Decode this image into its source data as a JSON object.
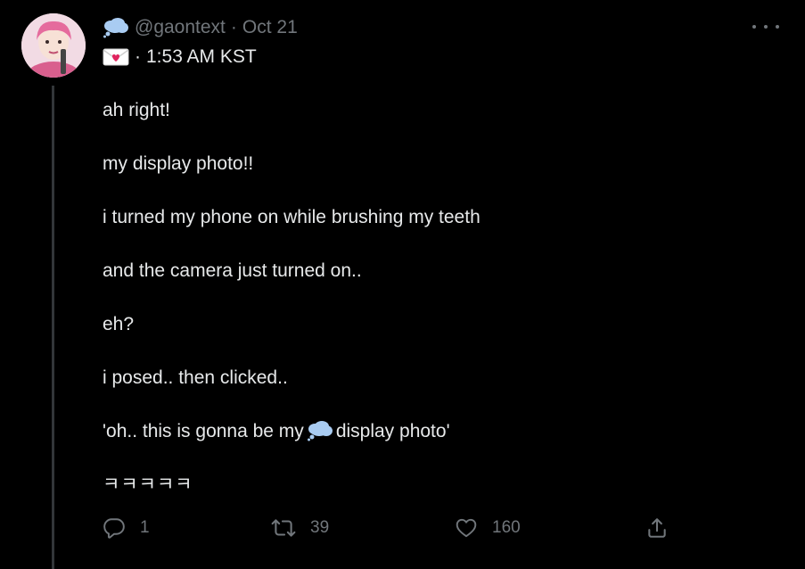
{
  "tweet": {
    "handle": "@gaontext",
    "separator": "·",
    "date": "Oct 21",
    "time_text": "1:53 AM KST",
    "lines": [
      "ah right!",
      "my display photo!!",
      "i turned my phone on while brushing my teeth",
      "and the camera just turned on..",
      "eh?",
      "i posed.. then clicked..",
      "ㅋㅋㅋㅋㅋ"
    ],
    "quote_line": {
      "before": "'oh.. this is gonna be my",
      "after": "display photo'"
    }
  },
  "actions": {
    "reply_count": "1",
    "retweet_count": "39",
    "like_count": "160"
  },
  "icons": {
    "reply": "reply-icon",
    "retweet": "retweet-icon",
    "like": "heart-icon",
    "share": "share-icon",
    "more": "more-icon",
    "header_emoji": "thought-balloon-icon",
    "time_emoji": "love-letter-icon"
  },
  "colors": {
    "background": "#000000",
    "text": "#e7e9ea",
    "muted": "#71767b",
    "thread_line": "#333639",
    "cloud": "#a9ccf2",
    "heart": "#e0245e"
  }
}
